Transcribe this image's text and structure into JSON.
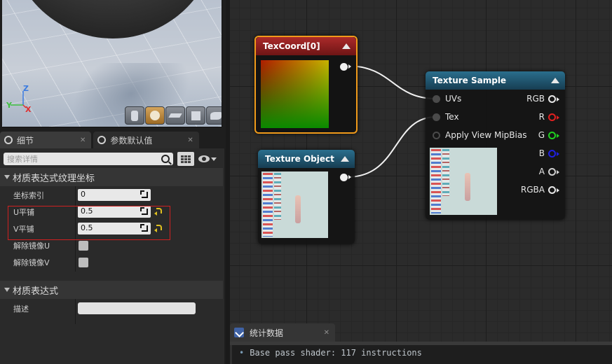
{
  "viewport": {
    "axis_z": "Z",
    "axis_y": "Y",
    "axis_x": "X",
    "toolbar": [
      "cylinder-preview-icon",
      "sphere-preview-icon",
      "plane-preview-icon",
      "cube-preview-icon",
      "custom-mesh-preview-icon"
    ]
  },
  "details_tabs": [
    {
      "label": "细节",
      "active": true
    },
    {
      "label": "参数默认值",
      "active": false
    }
  ],
  "details": {
    "search_placeholder": "搜索详情",
    "category1": "材质表达式纹理坐标",
    "props1": [
      {
        "label": "坐标索引",
        "value": "0"
      },
      {
        "label": "U平铺",
        "value": "0.5"
      },
      {
        "label": "V平铺",
        "value": "0.5"
      },
      {
        "label": "解除镜像U"
      },
      {
        "label": "解除镜像V"
      }
    ],
    "category2": "材质表达式",
    "props2": [
      {
        "label": "描述",
        "value": ""
      }
    ]
  },
  "nodes": {
    "texcoord": {
      "title": "TexCoord[0]"
    },
    "texobj": {
      "title": "Texture Object"
    },
    "texsample": {
      "title": "Texture Sample",
      "inputs": [
        "UVs",
        "Tex",
        "Apply View MipBias"
      ],
      "outputs": [
        {
          "label": "RGB",
          "color": "#e8e8e8"
        },
        {
          "label": "R",
          "color": "#e02020"
        },
        {
          "label": "G",
          "color": "#20d020"
        },
        {
          "label": "B",
          "color": "#2020e0"
        },
        {
          "label": "A",
          "color": "#cfcfcf"
        },
        {
          "label": "RGBA",
          "color": "#e8e8e8"
        }
      ]
    }
  },
  "stats": {
    "tab_label": "统计数据",
    "line": "Base pass shader: 117 instructions"
  }
}
